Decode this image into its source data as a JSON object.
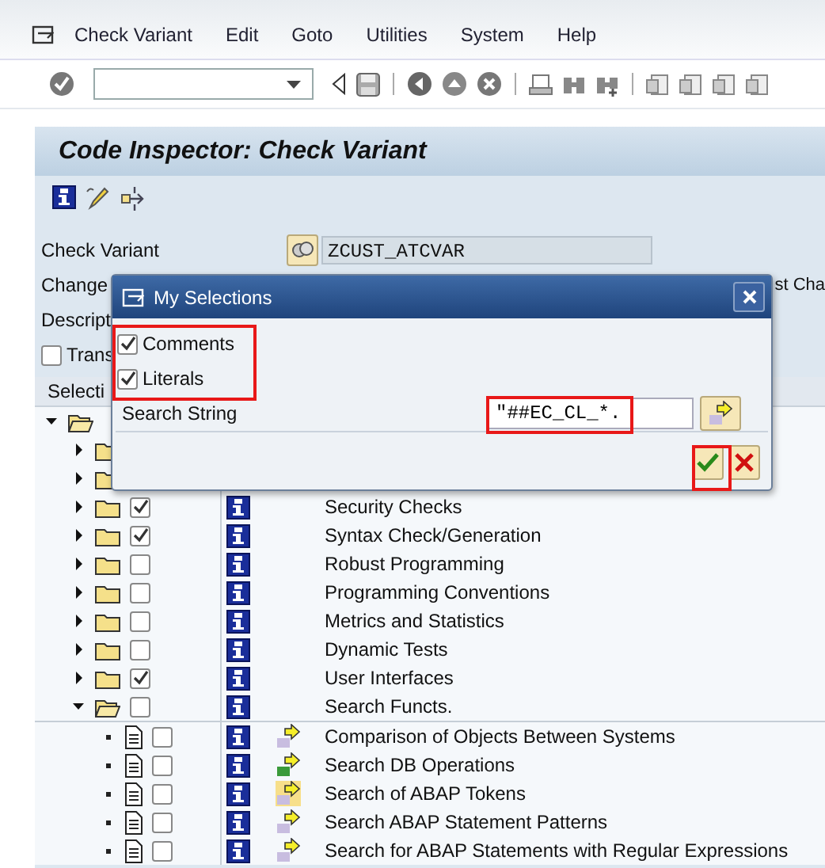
{
  "menu_bar": {
    "items": [
      "Check Variant",
      "Edit",
      "Goto",
      "Utilities",
      "System",
      "Help"
    ]
  },
  "title": "Code Inspector: Check Variant",
  "form": {
    "check_variant": {
      "label": "Check Variant",
      "value": "ZCUST_ATCVAR"
    },
    "changed_label": "Change",
    "right_label": "st Cha",
    "description_label": "Descript",
    "transport": {
      "label": "Trans",
      "checked": false
    }
  },
  "tree": {
    "header": "Selecti",
    "items": [
      {
        "expanded": true,
        "children": [
          {
            "expanded": false
          },
          {
            "expanded": false
          },
          {
            "label": "Security Checks",
            "expanded": false,
            "checked": true
          },
          {
            "label": "Syntax Check/Generation",
            "expanded": false,
            "checked": true
          },
          {
            "label": "Robust Programming",
            "expanded": false,
            "checked": false
          },
          {
            "label": "Programming Conventions",
            "expanded": false,
            "checked": false
          },
          {
            "label": "Metrics and Statistics",
            "expanded": false,
            "checked": false
          },
          {
            "label": "Dynamic Tests",
            "expanded": false,
            "checked": false
          },
          {
            "label": "User Interfaces",
            "expanded": false,
            "checked": true
          },
          {
            "label": "Search Functs.",
            "expanded": true,
            "checked": false,
            "children": [
              {
                "label": "Comparison of Objects Between Systems",
                "checked": false,
                "selected": false
              },
              {
                "label": "Search DB Operations",
                "checked": false,
                "selected": false
              },
              {
                "label": "Search of ABAP Tokens",
                "checked": false,
                "selected": true
              },
              {
                "label": "Search ABAP Statement Patterns",
                "checked": false,
                "selected": false
              },
              {
                "label": "Search for ABAP Statements with Regular Expressions",
                "checked": false,
                "selected": false
              }
            ]
          }
        ]
      }
    ]
  },
  "dialog": {
    "title": "My Selections",
    "options": [
      {
        "label": "Comments",
        "checked": true
      },
      {
        "label": "Literals",
        "checked": true
      }
    ],
    "search": {
      "label": "Search String",
      "value": "\"##EC_CL_*."
    }
  }
}
